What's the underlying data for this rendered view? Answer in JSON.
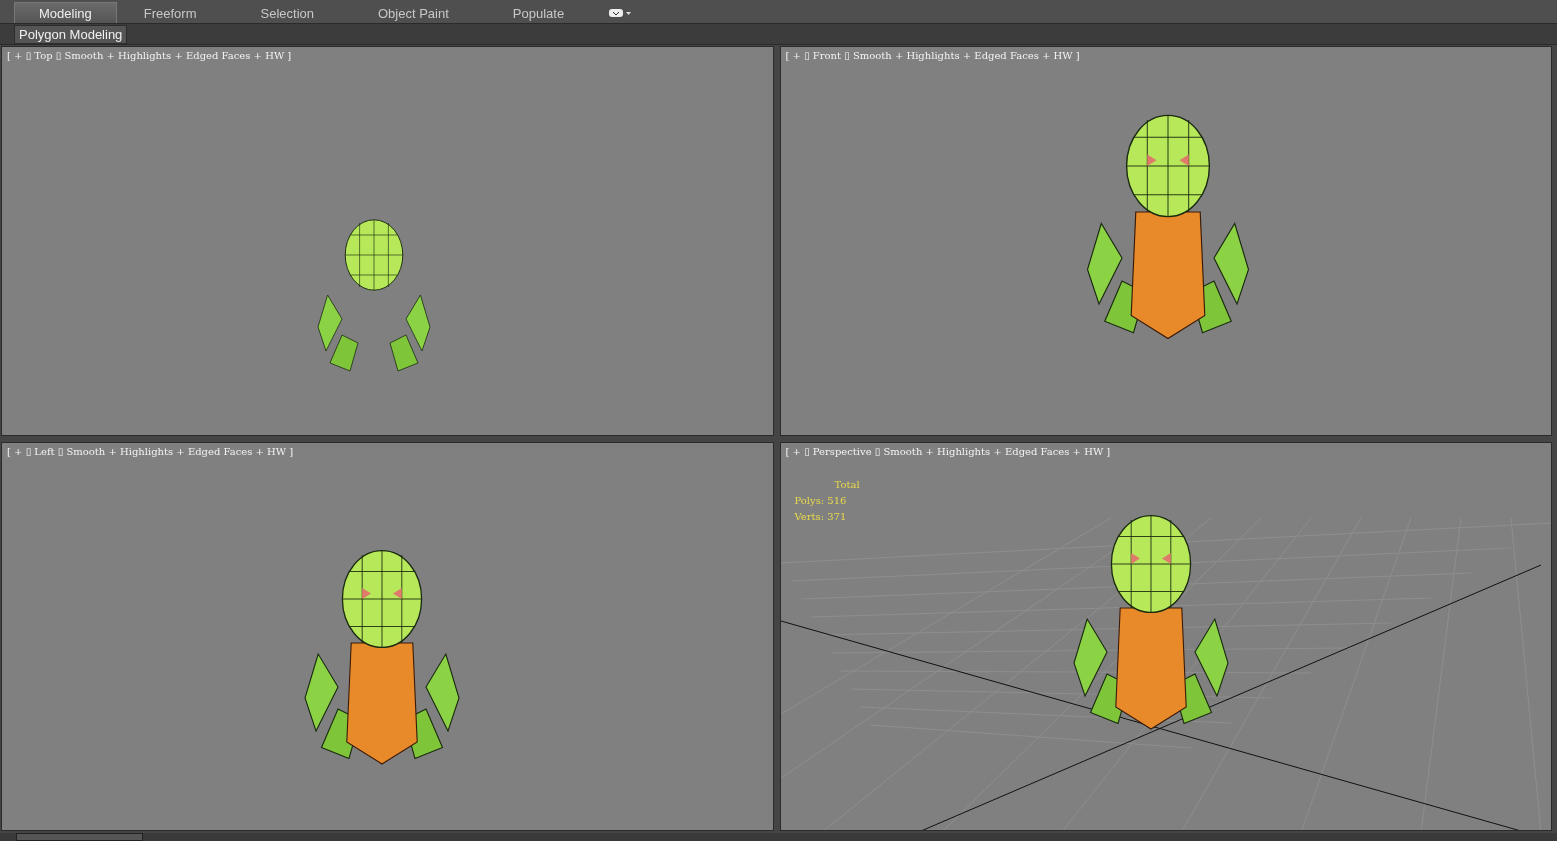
{
  "ribbon": {
    "tabs": [
      {
        "label": "Modeling",
        "selected": true
      },
      {
        "label": "Freeform",
        "selected": false
      },
      {
        "label": "Selection",
        "selected": false
      },
      {
        "label": "Object Paint",
        "selected": false
      },
      {
        "label": "Populate",
        "selected": false
      }
    ],
    "panel_label": "Polygon Modeling"
  },
  "viewports": [
    {
      "kind": "top",
      "label": "[ + ▯ Top ▯ Smooth + Highlights + Edged Faces + HW ]"
    },
    {
      "kind": "front",
      "label": "[ + ▯ Front ▯ Smooth + Highlights + Edged Faces + HW ]"
    },
    {
      "kind": "left",
      "label": "[ + ▯ Left ▯ Smooth + Highlights + Edged Faces + HW ]"
    },
    {
      "kind": "perspective",
      "label": "[ + ▯ Perspective ▯ Smooth + Highlights + Edged Faces + HW ]",
      "stats": {
        "title": "Total",
        "lines": [
          "Polys: 516",
          "Verts: 371"
        ]
      }
    }
  ]
}
